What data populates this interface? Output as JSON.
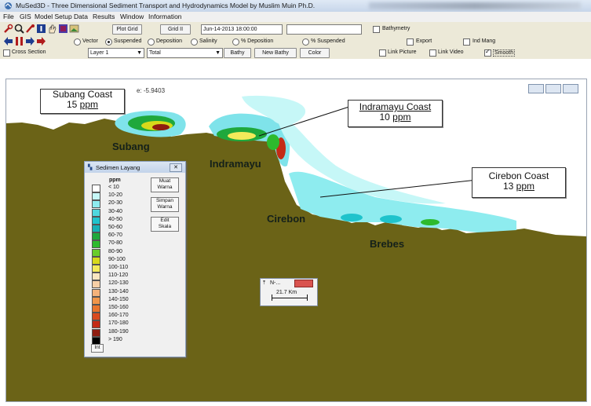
{
  "window": {
    "title": "MuSed3D - Three Dimensional Sediment Transport and Hydrodynamics Model by Muslim Muin Ph.D."
  },
  "menu": [
    "File",
    "GIS",
    "Model Setup",
    "Data",
    "Results",
    "Window",
    "Information"
  ],
  "toolbar1": {
    "plot_grid": "Plot Grid",
    "grid_toggle": "Grid II",
    "datetime": "Jun-14-2013 18:00:00",
    "bathymetry": "Bathymetry"
  },
  "toolbar2": {
    "options": [
      "Vector",
      "Suspended",
      "Deposition",
      "Salinity",
      "% Deposition",
      "% Suspended"
    ],
    "selected": "Suspended",
    "export": "Export",
    "ind_mang": "Ind Mang"
  },
  "toolbar3": {
    "cross_section": "Cross Section",
    "layer": "Layer 1",
    "mode": "Total",
    "bathy": "Bathy",
    "new_bathy": "New Bathy",
    "color": "Color",
    "link_picture": "Link Picture",
    "link_video": "Link Video",
    "smooth": "Smooth",
    "smooth_checked": true
  },
  "map": {
    "readout": "e: -5.9403",
    "places": [
      "Subang",
      "Indramayu",
      "Cirebon",
      "Brebes"
    ],
    "callouts": [
      {
        "name": "Subang Coast",
        "value": "15",
        "unit": "ppm"
      },
      {
        "name": "Indramayu Coast",
        "value": "10",
        "unit": "ppm"
      },
      {
        "name": "Cirebon Coast",
        "value": "13",
        "unit": "ppm"
      }
    ],
    "colors": {
      "land": "#6b6317",
      "sea": "#ffffff"
    }
  },
  "palette": {
    "title": "Sedimen Layang",
    "unit": "ppm",
    "buttons": [
      "Muat\nWarna",
      "Simpan\nWarna",
      "Edit\nSkala"
    ],
    "int_button": "Int",
    "legend": [
      {
        "label": "< 10",
        "color": "#ffffff"
      },
      {
        "label": "10-20",
        "color": "#c6f7f7"
      },
      {
        "label": "20-30",
        "color": "#8eecef"
      },
      {
        "label": "30-40",
        "color": "#4fd7de"
      },
      {
        "label": "40-50",
        "color": "#1fc3cc"
      },
      {
        "label": "50-60",
        "color": "#17b0b5"
      },
      {
        "label": "60-70",
        "color": "#1fa83c"
      },
      {
        "label": "70-80",
        "color": "#2dba2d"
      },
      {
        "label": "80-90",
        "color": "#6acd2b"
      },
      {
        "label": "90-100",
        "color": "#d7d91a"
      },
      {
        "label": "100-110",
        "color": "#f3ea5a"
      },
      {
        "label": "110-120",
        "color": "#f9e6c1"
      },
      {
        "label": "120-130",
        "color": "#f7cfa6"
      },
      {
        "label": "130-140",
        "color": "#f4b27a"
      },
      {
        "label": "140-150",
        "color": "#ef9549"
      },
      {
        "label": "150-160",
        "color": "#e8742d"
      },
      {
        "label": "160-170",
        "color": "#d94a1f"
      },
      {
        "label": "170-180",
        "color": "#c42b16"
      },
      {
        "label": "180-190",
        "color": "#8f1c10"
      },
      {
        "label": "> 190",
        "color": "#000000"
      }
    ]
  },
  "scale_window": {
    "title": "N-...",
    "label": "21.7 Km"
  }
}
